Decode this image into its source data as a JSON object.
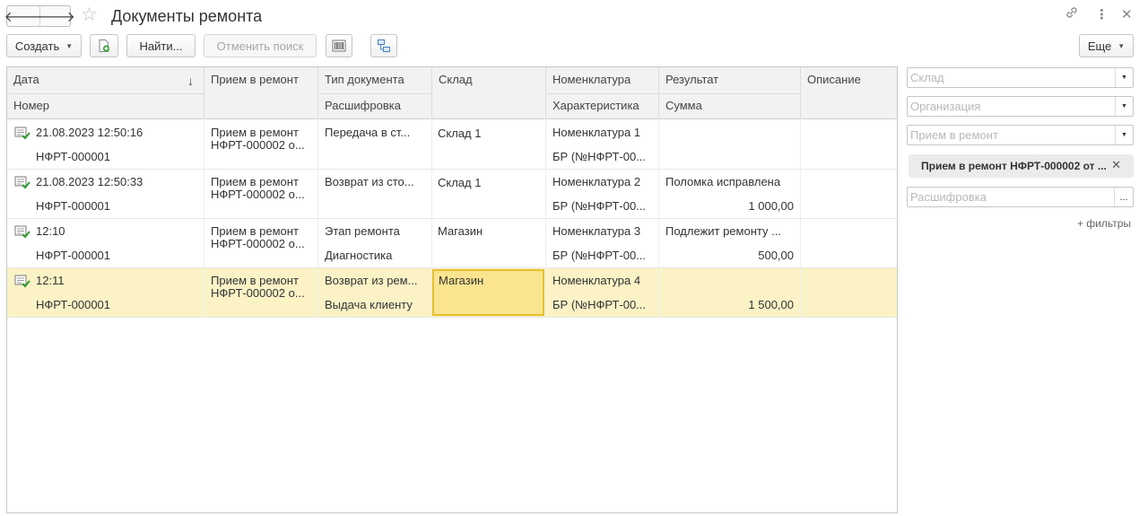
{
  "title": "Документы ремонта",
  "nav": {
    "back_glyph": "🡐",
    "forward_glyph": "🡒",
    "back_icon": "arrow-left-icon",
    "forward_icon": "arrow-right-icon"
  },
  "title_icons": {
    "favorite": "star-icon",
    "link": "link-icon",
    "more": "more-icon",
    "close": "close-icon"
  },
  "toolbar": {
    "create_label": "Создать",
    "find_label": "Найти...",
    "cancel_search_label": "Отменить поиск",
    "more_label": "Еще"
  },
  "table": {
    "headers": {
      "date": "Дата",
      "number": "Номер",
      "repair_intake": "Прием в ремонт",
      "doc_type": "Тип документа",
      "decoding": "Расшифровка",
      "warehouse": "Склад",
      "nomenclature": "Номенклатура",
      "characteristic": "Характеристика",
      "result": "Результат",
      "amount": "Сумма",
      "description": "Описание",
      "sort_indicator": "↓"
    },
    "rows": [
      {
        "date": "21.08.2023 12:50:16",
        "number": "НФРТ-000001",
        "intake_line1": "Прием в ремонт",
        "intake_line2": "НФРТ-000002 о...",
        "doc_type": "Передача в ст...",
        "decoding": "",
        "warehouse": "Склад 1",
        "nomenclature": "Номенклатура 1",
        "characteristic": "БР (№НФРТ-00...",
        "result": "",
        "amount": "",
        "description": ""
      },
      {
        "date": "21.08.2023 12:50:33",
        "number": "НФРТ-000001",
        "intake_line1": "Прием в ремонт",
        "intake_line2": "НФРТ-000002 о...",
        "doc_type": "Возврат из сто...",
        "decoding": "",
        "warehouse": "Склад 1",
        "nomenclature": "Номенклатура 2",
        "characteristic": "БР (№НФРТ-00...",
        "result": "Поломка исправлена",
        "amount": "1 000,00",
        "description": ""
      },
      {
        "date": "12:10",
        "number": "НФРТ-000001",
        "intake_line1": "Прием в ремонт",
        "intake_line2": "НФРТ-000002 о...",
        "doc_type": "Этап ремонта",
        "decoding": "Диагностика",
        "warehouse": "Магазин",
        "nomenclature": "Номенклатура 3",
        "characteristic": "БР (№НФРТ-00...",
        "result": "Подлежит ремонту ...",
        "amount": "500,00",
        "description": ""
      },
      {
        "date": "12:11",
        "number": "НФРТ-000001",
        "intake_line1": "Прием в ремонт",
        "intake_line2": "НФРТ-000002 о...",
        "doc_type": "Возврат из рем...",
        "decoding": "Выдача клиенту",
        "warehouse": "Магазин",
        "nomenclature": "Номенклатура 4",
        "characteristic": "БР (№НФРТ-00...",
        "result": "",
        "amount": "1 500,00",
        "description": ""
      }
    ]
  },
  "filters": {
    "warehouse_placeholder": "Склад",
    "organization_placeholder": "Организация",
    "intake_placeholder": "Прием в ремонт",
    "active_chip": "Прием в ремонт НФРТ-000002 от ...",
    "decoding_placeholder": "Расшифровка",
    "select_glyph": "...",
    "add_filters": "+ фильтры"
  },
  "colors": {
    "selected_row": "#fbf3c6",
    "active_cell": "#fbe490",
    "active_cell_border": "#e6c02a"
  }
}
